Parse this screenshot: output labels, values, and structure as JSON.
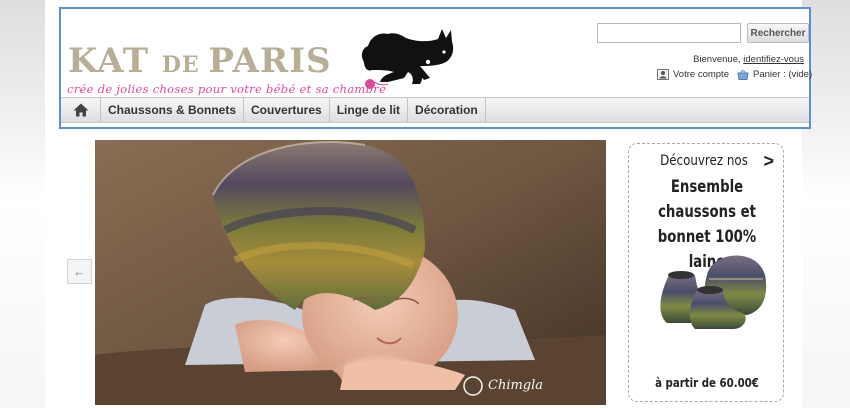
{
  "brand": {
    "name_part1": "KAT ",
    "name_part2": "DE ",
    "name_part3": "PARIS",
    "tagline": "crée de jolies choses pour votre bébé et sa chambre"
  },
  "search": {
    "value": "",
    "placeholder": "",
    "button_label": "Rechercher"
  },
  "user": {
    "welcome_text": "Bienvenue, ",
    "login_link": "identifiez-vous",
    "account_label": "Votre compte",
    "cart_label": "Panier : (vide)"
  },
  "nav": {
    "items": [
      {
        "label": "Chaussons & Bonnets"
      },
      {
        "label": "Couvertures"
      },
      {
        "label": "Linge de lit"
      },
      {
        "label": "Décoration"
      }
    ]
  },
  "slider": {
    "prev_arrow": "←",
    "next_arrow": "→",
    "watermark": "Chimgla"
  },
  "promo": {
    "discover_label": "Découvrez nos",
    "chevron": ">",
    "title_line1": "Ensemble chaussons et",
    "title_line2": "bonnet 100% laine",
    "price_label": "à partir de 60.00€"
  },
  "colors": {
    "accent_border": "#5b8ed8",
    "logo_text": "#b8ae96",
    "tagline": "#e2479a"
  }
}
